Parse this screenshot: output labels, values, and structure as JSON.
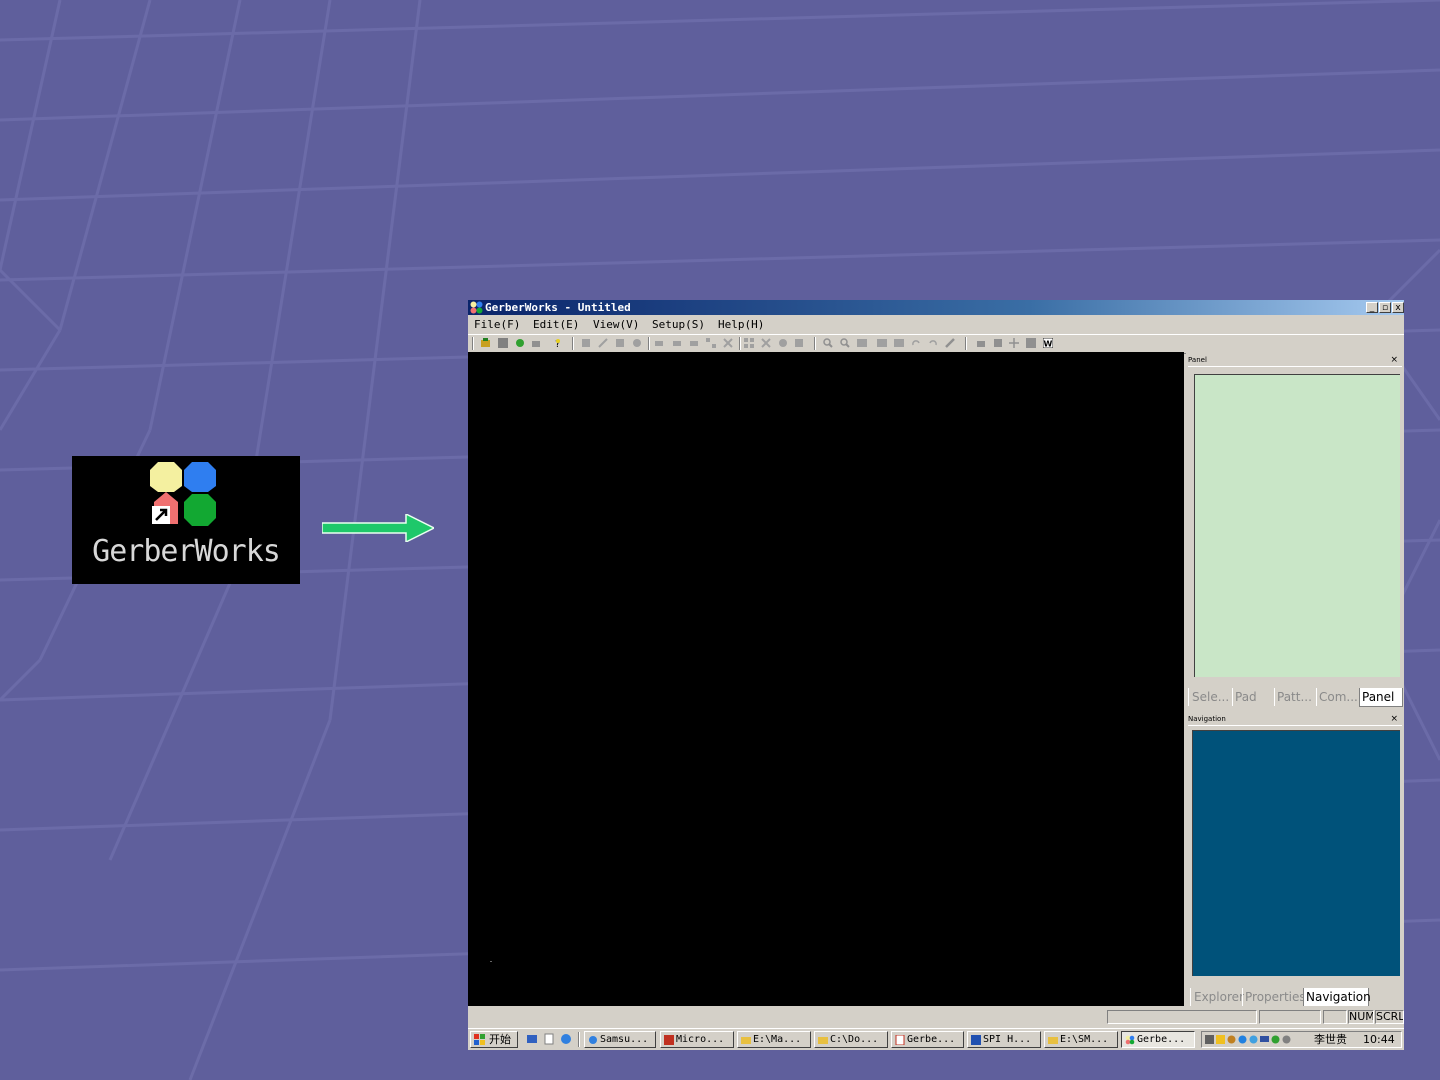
{
  "desktop": {
    "shortcut_label": "GerberWorks"
  },
  "window": {
    "title": "GerberWorks - Untitled",
    "controls": {
      "minimize": "_",
      "maximize": "▫",
      "close": "x"
    }
  },
  "menu": [
    "File(F)",
    "Edit(E)",
    "View(V)",
    "Setup(S)",
    "Help(H)"
  ],
  "side_panel": {
    "panel_title": "Panel",
    "panel_tabs": [
      "Sele...",
      "Pad",
      "Patt...",
      "Com...",
      "Panel"
    ],
    "panel_active_tab": "Panel",
    "navigation_title": "Navigation",
    "navigation_tabs": [
      "Explorer",
      "Properties",
      "Navigation"
    ],
    "navigation_active_tab": "Navigation",
    "close_glyph": "×"
  },
  "statusbar": {
    "num": "NUM",
    "scrl": "SCRL"
  },
  "taskbar": {
    "start_label": "开始",
    "buttons": [
      "Samsu...",
      "Micro...",
      "E:\\Ma...",
      "C:\\Do...",
      "Gerbe...",
      "SPI H...",
      "E:\\SM...",
      "Gerbe..."
    ],
    "active_index": 7,
    "tray_user": "李世贵",
    "tray_time": "10:44"
  },
  "colors": {
    "canvas": "#000000",
    "panel_bg": "#c9e6c7",
    "navigation_bg": "#00527a",
    "titlebar": "#0a246a",
    "arrow": "#1ec86a",
    "desktop": "#5f5f9c"
  }
}
